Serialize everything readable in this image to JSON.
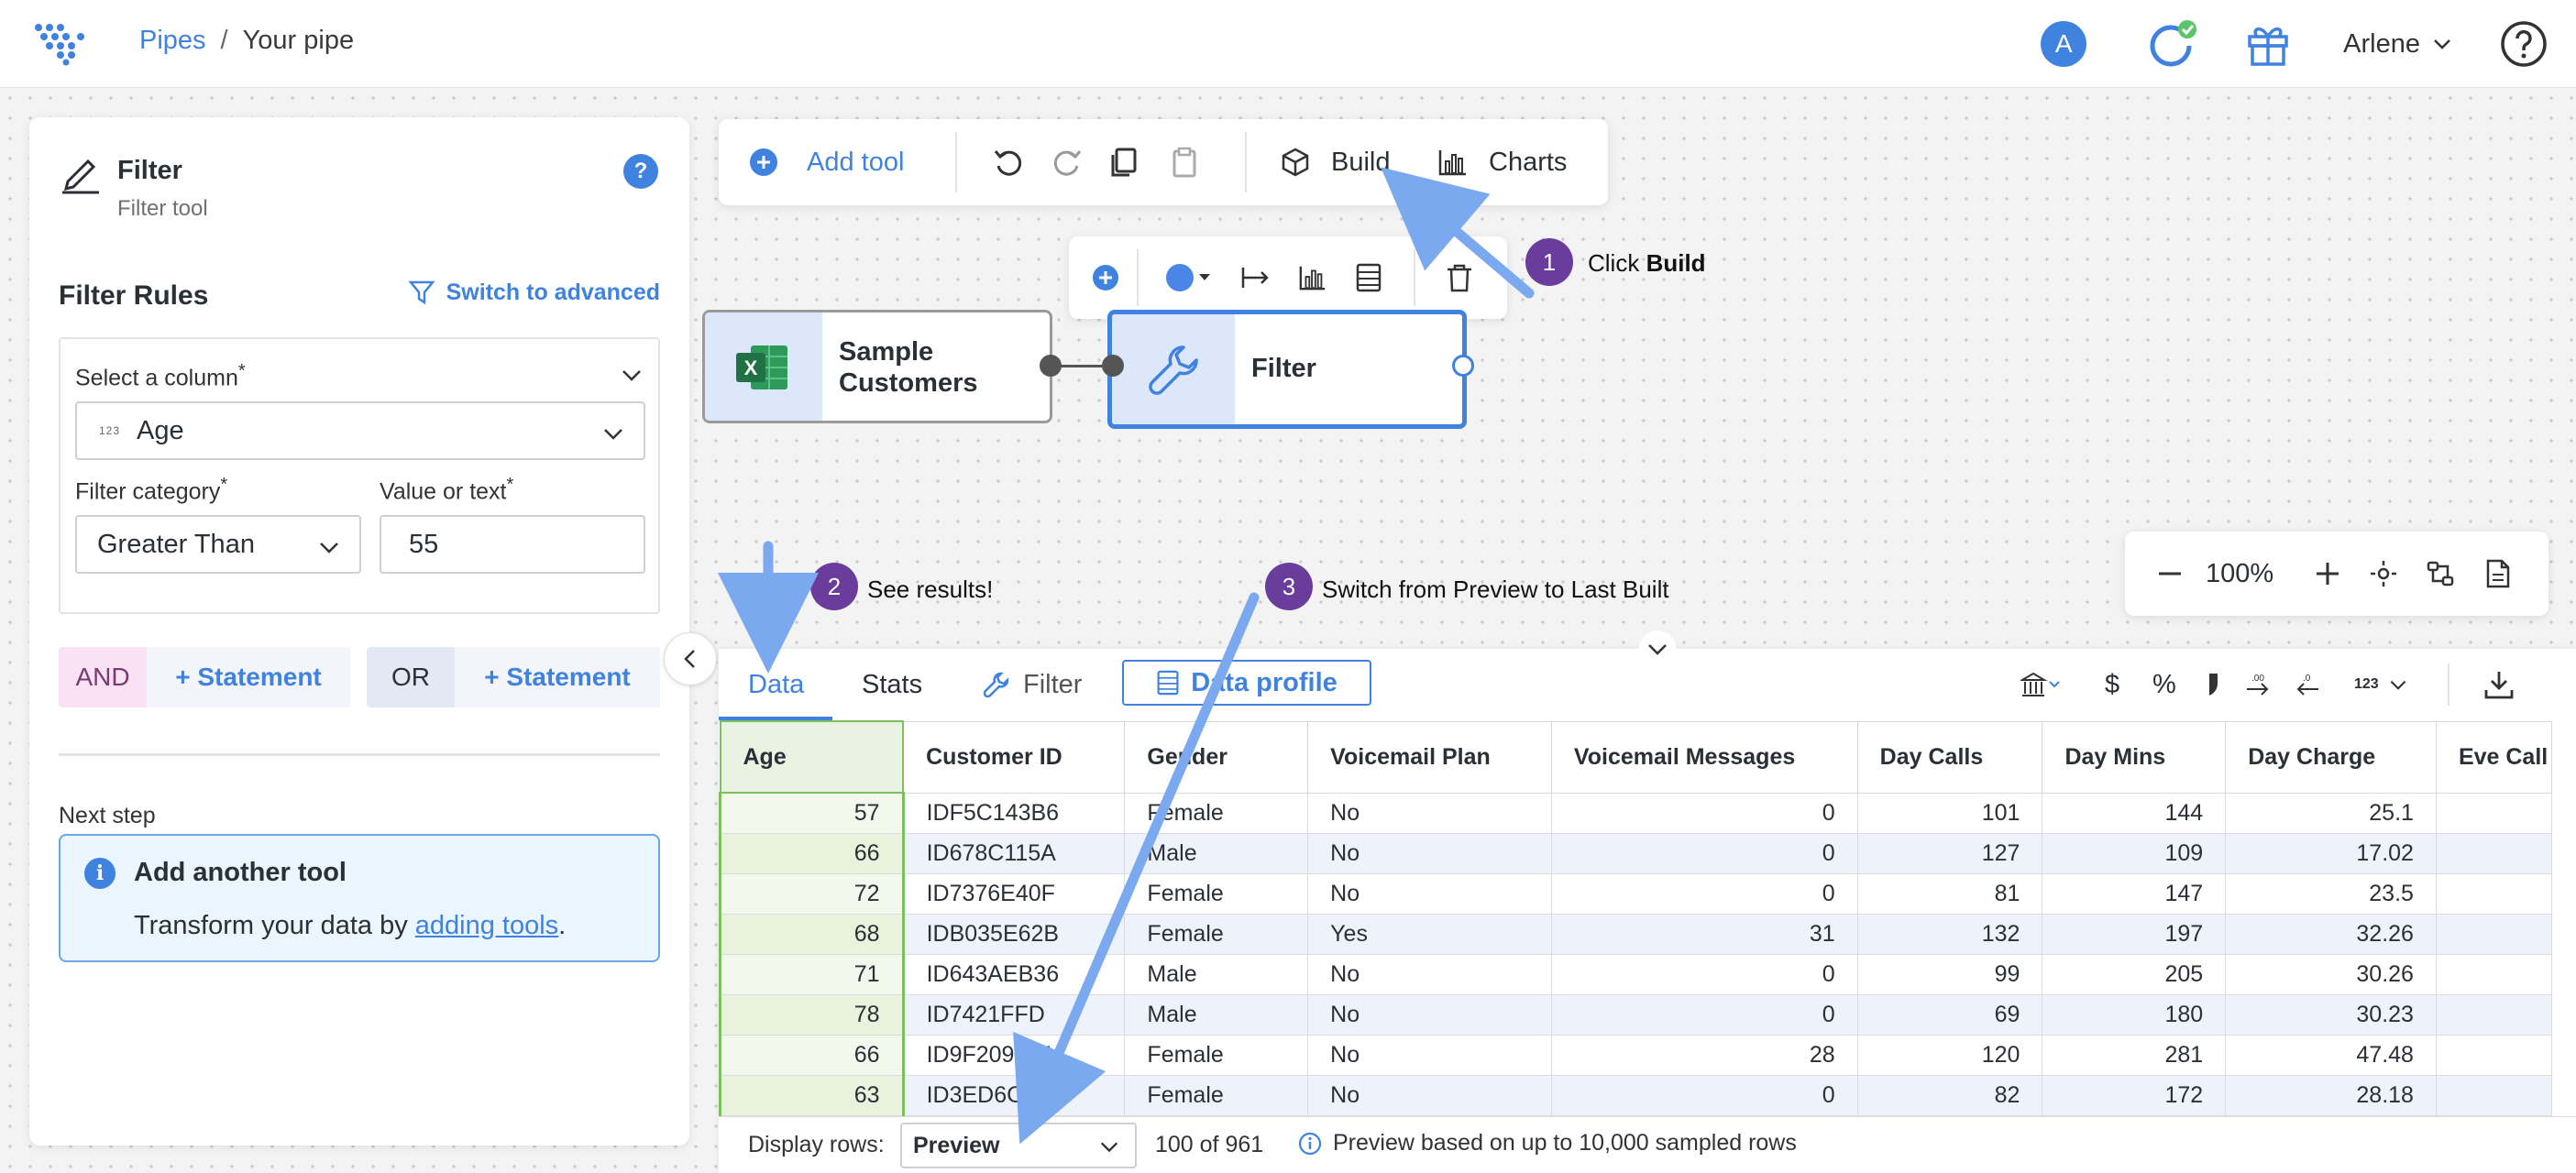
{
  "header": {
    "breadcrumb": {
      "root": "Pipes",
      "separator": "/",
      "current": "Your pipe"
    },
    "avatar_letter": "A",
    "user_name": "Arlene",
    "icons": [
      "dots-logo-icon",
      "sync-icon",
      "gift-icon",
      "chevron-down-icon",
      "help-icon"
    ]
  },
  "panel": {
    "title": "Filter",
    "subtitle": "Filter tool",
    "help_label": "?",
    "rules_title": "Filter Rules",
    "switch_label": "Switch to advanced",
    "column_label": "Select a column",
    "column_value": "Age",
    "column_type_tag": "123",
    "category_label": "Filter category",
    "category_value": "Greater Than",
    "value_label": "Value or text",
    "value_value": "55",
    "required_mark": "*",
    "and_label": "AND",
    "or_label": "OR",
    "statement_label": "+ Statement",
    "next_step_label": "Next step",
    "next_card_title": "Add another tool",
    "next_card_text_before": "Transform your data by ",
    "next_card_link": "adding tools",
    "next_card_text_after": ".",
    "info_glyph": "i"
  },
  "toolbar": {
    "add_tool_label": "Add tool",
    "build_label": "Build",
    "charts_label": "Charts"
  },
  "nodes": {
    "source_line1": "Sample",
    "source_line2": "Customers",
    "filter_label": "Filter",
    "excel_glyph": "X"
  },
  "zoom": {
    "level": "100%"
  },
  "annotations": [
    {
      "number": "1",
      "text_plain": "Click ",
      "text_bold": "Build"
    },
    {
      "number": "2",
      "text_plain": "See results!"
    },
    {
      "number": "3",
      "text_plain": "Switch from Preview to Last Built"
    }
  ],
  "data_tabs": {
    "data": "Data",
    "stats": "Stats",
    "filter": "Filter",
    "profile": "Data profile"
  },
  "format_icons": {
    "currency": "$",
    "percent": "%",
    "number_format": "123"
  },
  "table": {
    "columns": [
      "Age",
      "Customer ID",
      "Gender",
      "Voicemail Plan",
      "Voicemail Messages",
      "Day Calls",
      "Day Mins",
      "Day Charge",
      "Eve Call"
    ],
    "rows": [
      [
        "57",
        "IDF5C143B6",
        "Female",
        "No",
        "0",
        "101",
        "144",
        "25.1",
        ""
      ],
      [
        "66",
        "ID678C115A",
        "Male",
        "No",
        "0",
        "127",
        "109",
        "17.02",
        ""
      ],
      [
        "72",
        "ID7376E40F",
        "Female",
        "No",
        "0",
        "81",
        "147",
        "23.5",
        ""
      ],
      [
        "68",
        "IDB035E62B",
        "Female",
        "Yes",
        "31",
        "132",
        "197",
        "32.26",
        ""
      ],
      [
        "71",
        "ID643AEB36",
        "Male",
        "No",
        "0",
        "99",
        "205",
        "30.26",
        ""
      ],
      [
        "78",
        "ID7421FFD",
        "Male",
        "No",
        "0",
        "69",
        "180",
        "30.23",
        ""
      ],
      [
        "66",
        "ID9F209117",
        "Female",
        "No",
        "28",
        "120",
        "281",
        "47.48",
        ""
      ],
      [
        "63",
        "ID3ED6C1TC",
        "Female",
        "No",
        "0",
        "82",
        "172",
        "28.18",
        ""
      ]
    ]
  },
  "footer": {
    "display_label": "Display rows:",
    "select_value": "Preview",
    "count_text": "100 of 961",
    "info_text": "Preview based on up to 10,000 sampled rows"
  },
  "colors": {
    "accent": "#3f82e0",
    "annotation_badge": "#6a3c9c",
    "annotation_arrow": "#7aa9f0",
    "selected_column": "#7cbf5e",
    "excel_green": "#1f7244"
  }
}
